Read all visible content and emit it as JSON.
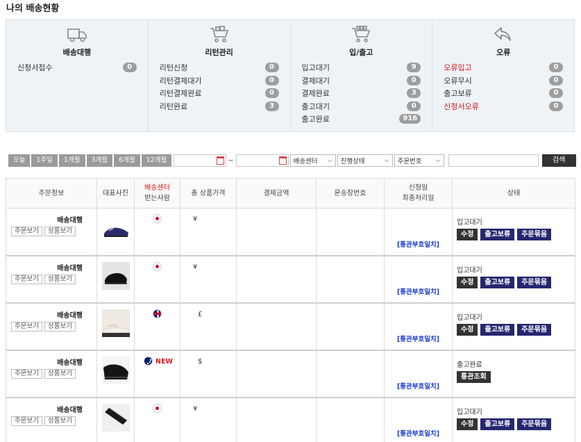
{
  "page_title": "나의 배송현황",
  "summary": [
    {
      "title": "배송대행",
      "icon": "truck-icon",
      "items": [
        {
          "label": "신청서접수",
          "count": "0",
          "red": false
        }
      ]
    },
    {
      "title": "리턴관리",
      "icon": "cart-icon",
      "items": [
        {
          "label": "리턴신청",
          "count": "0",
          "red": false
        },
        {
          "label": "리턴결제대기",
          "count": "0",
          "red": false
        },
        {
          "label": "리턴결제완료",
          "count": "0",
          "red": false
        },
        {
          "label": "리턴완료",
          "count": "3",
          "red": false
        }
      ]
    },
    {
      "title": "입/출고",
      "icon": "warehouse-cart-icon",
      "items": [
        {
          "label": "입고대기",
          "count": "9",
          "red": false
        },
        {
          "label": "결제대기",
          "count": "0",
          "red": false
        },
        {
          "label": "결제완료",
          "count": "3",
          "red": false
        },
        {
          "label": "출고대기",
          "count": "0",
          "red": false
        },
        {
          "label": "출고완료",
          "count": "916",
          "red": false
        }
      ]
    },
    {
      "title": "오류",
      "icon": "return-arrow-icon",
      "items": [
        {
          "label": "오류입고",
          "count": "0",
          "red": true
        },
        {
          "label": "오류무시",
          "count": "0",
          "red": false
        },
        {
          "label": "출고보류",
          "count": "0",
          "red": false
        },
        {
          "label": "신청서오류",
          "count": "0",
          "red": true
        }
      ]
    }
  ],
  "filters": {
    "periods": [
      "오늘",
      "1주일",
      "1개월",
      "3개월",
      "6개월",
      "12개월"
    ],
    "date_separator": "~",
    "selects": [
      "배송센터",
      "진행상태",
      "주문번호"
    ],
    "search_label": "검색"
  },
  "table": {
    "headers": {
      "order_info": "주문정보",
      "photo": "대표사진",
      "center": "배송센터",
      "receiver": "받는사람",
      "total_price": "총 상품가격",
      "payment": "결제금액",
      "tracking": "운송장번호",
      "req_date": "신청일",
      "last_date": "최종처리일",
      "status": "상태"
    },
    "order_view_label": "주문보기",
    "product_view_label": "상품보기",
    "rows": [
      {
        "type": "배송대행",
        "flag": "jp",
        "new": "",
        "currency": "¥",
        "customs": "[통관부호일치]",
        "status": "입고대기",
        "actions": [
          "수정",
          "출고보류",
          "주문묶음"
        ],
        "photo": "blue-sneaker"
      },
      {
        "type": "배송대행",
        "flag": "jp",
        "new": "",
        "currency": "¥",
        "customs": "[통관부호일치]",
        "status": "입고대기",
        "actions": [
          "수정",
          "출고보류",
          "주문묶음"
        ],
        "photo": "black-shoe"
      },
      {
        "type": "배송대행",
        "flag": "uk",
        "new": "",
        "currency": "£",
        "customs": "[통관부호일치]",
        "status": "입고대기",
        "actions": [
          "수정",
          "출고보류",
          "주문묶음"
        ],
        "photo": "slide-sandal"
      },
      {
        "type": "배송대행",
        "flag": "au",
        "new": "NEW",
        "currency": "$",
        "customs": "[통관부호일치]",
        "status": "출고완료",
        "actions": [
          "통관조회"
        ],
        "photo": "black-sneaker"
      },
      {
        "type": "배송대행",
        "flag": "jp",
        "new": "",
        "currency": "¥",
        "customs": "[통관부호일치]",
        "status": "입고대기",
        "actions": [
          "수정",
          "출고보류",
          "주문묶음"
        ],
        "photo": "black-strap"
      }
    ]
  }
}
